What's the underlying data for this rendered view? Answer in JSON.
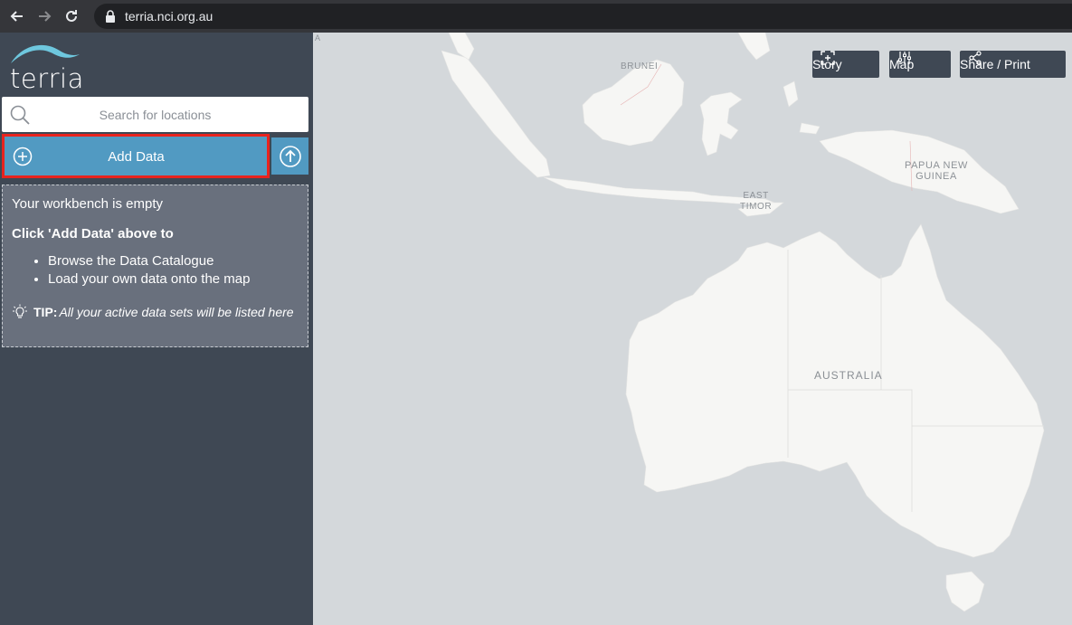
{
  "browser": {
    "url": "terria.nci.org.au"
  },
  "app": {
    "logo_text": "terria",
    "search_placeholder": "Search for locations",
    "add_data_label": "Add Data"
  },
  "workbench": {
    "title": "Your workbench is empty",
    "subtitle": "Click 'Add Data' above to",
    "items": [
      "Browse the Data Catalogue",
      "Load your own data onto the map"
    ],
    "tip_label": "TIP:",
    "tip_text": "All your active data sets will be listed here"
  },
  "map_toolbar": {
    "story_label": "Story",
    "map_label": "Map",
    "share_label": "Share / Print"
  },
  "map_labels": {
    "brunei": "BRUNEI",
    "papua_line1": "PAPUA NEW",
    "papua_line2": "GUINEA",
    "timor_line1": "EAST",
    "timor_line2": "TIMOR",
    "australia": "AUSTRALIA",
    "attribution_mark": "A"
  },
  "colors": {
    "sidebar": "#3f4854",
    "accent": "#519ac2",
    "highlight": "#e8231e",
    "workbench": "#69707d",
    "land": "#f6f6f4",
    "sea": "#d4d8db"
  }
}
